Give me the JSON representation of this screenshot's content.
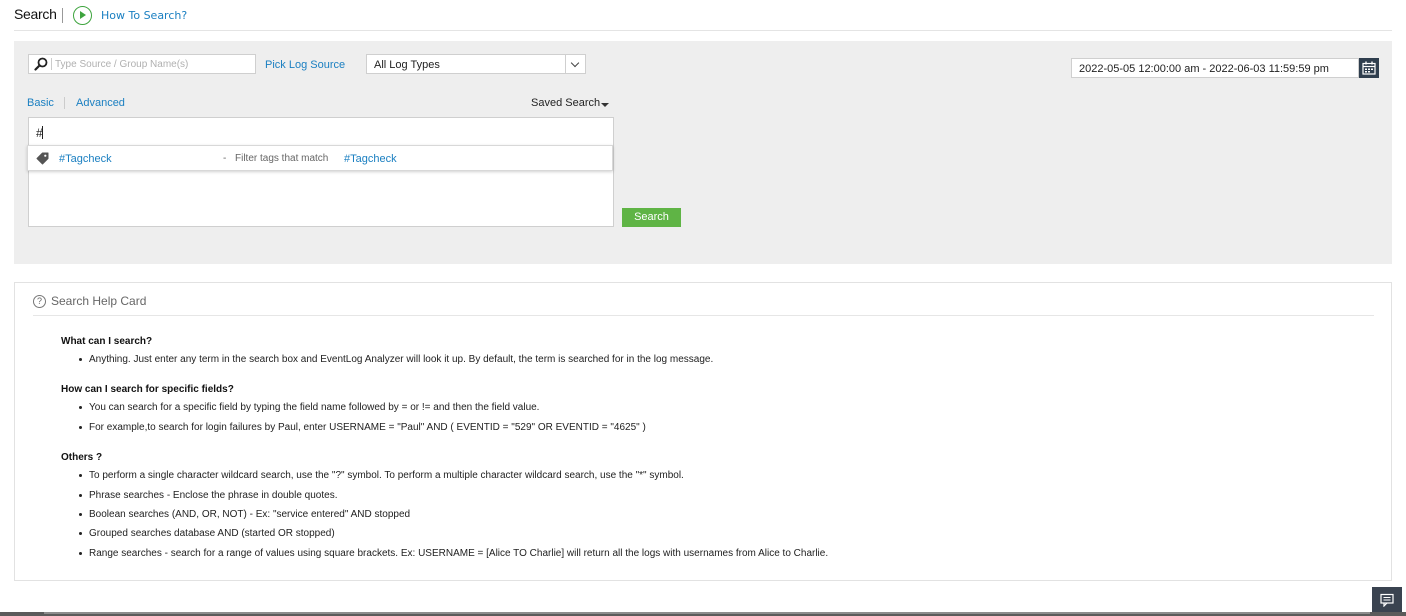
{
  "header": {
    "title": "Search",
    "how_to_link": "How To Search?"
  },
  "search": {
    "source_placeholder": "Type Source / Group Name(s)",
    "pick_log_source": "Pick Log Source",
    "log_type": "All Log Types",
    "date_range": "2022-05-05 12:00:00 am - 2022-06-03 11:59:59 pm",
    "tabs": [
      "Basic",
      "Advanced"
    ],
    "saved_search": "Saved Search",
    "query": "#",
    "suggestion": {
      "tag": "#Tagcheck",
      "separator": "-",
      "description": "Filter tags that match",
      "match": "#Tagcheck"
    },
    "search_button": "Search"
  },
  "help_card": {
    "title": "Search Help Card",
    "sections": [
      {
        "question": "What can I search?",
        "items": [
          "Anything. Just enter any term in the search box and EventLog Analyzer will look it up. By default, the term is searched for in the log message."
        ]
      },
      {
        "question": "How can I search for specific fields?",
        "items": [
          "You can search for a specific field by typing the field name followed by = or != and then the field value.",
          "For example,to search for login failures by Paul, enter USERNAME = \"Paul\" AND ( EVENTID = \"529\" OR EVENTID = \"4625\" )"
        ]
      },
      {
        "question": "Others ?",
        "items": [
          "To perform a single character wildcard search, use the \"?\" symbol. To perform a multiple character wildcard search, use the \"*\" symbol.",
          "Phrase searches - Enclose the phrase in double quotes.",
          "Boolean searches (AND, OR, NOT) - Ex: \"service entered\" AND stopped",
          "Grouped searches database AND (started OR stopped)",
          "Range searches - search for a range of values using square brackets. Ex: USERNAME = [Alice TO Charlie] will return all the logs with usernames from Alice to Charlie."
        ]
      }
    ]
  },
  "icons": {
    "how_to": "play-circle-icon",
    "source": "search-icon",
    "calendar": "calendar-icon",
    "tag": "tag-icon",
    "help": "question-circle-icon",
    "feedback": "chat-icon"
  },
  "colors": {
    "accent": "#1a7fc1",
    "search_button": "#5fb445",
    "panel_bg": "#eeeeee",
    "calendar_bg": "#2f3e4e"
  }
}
